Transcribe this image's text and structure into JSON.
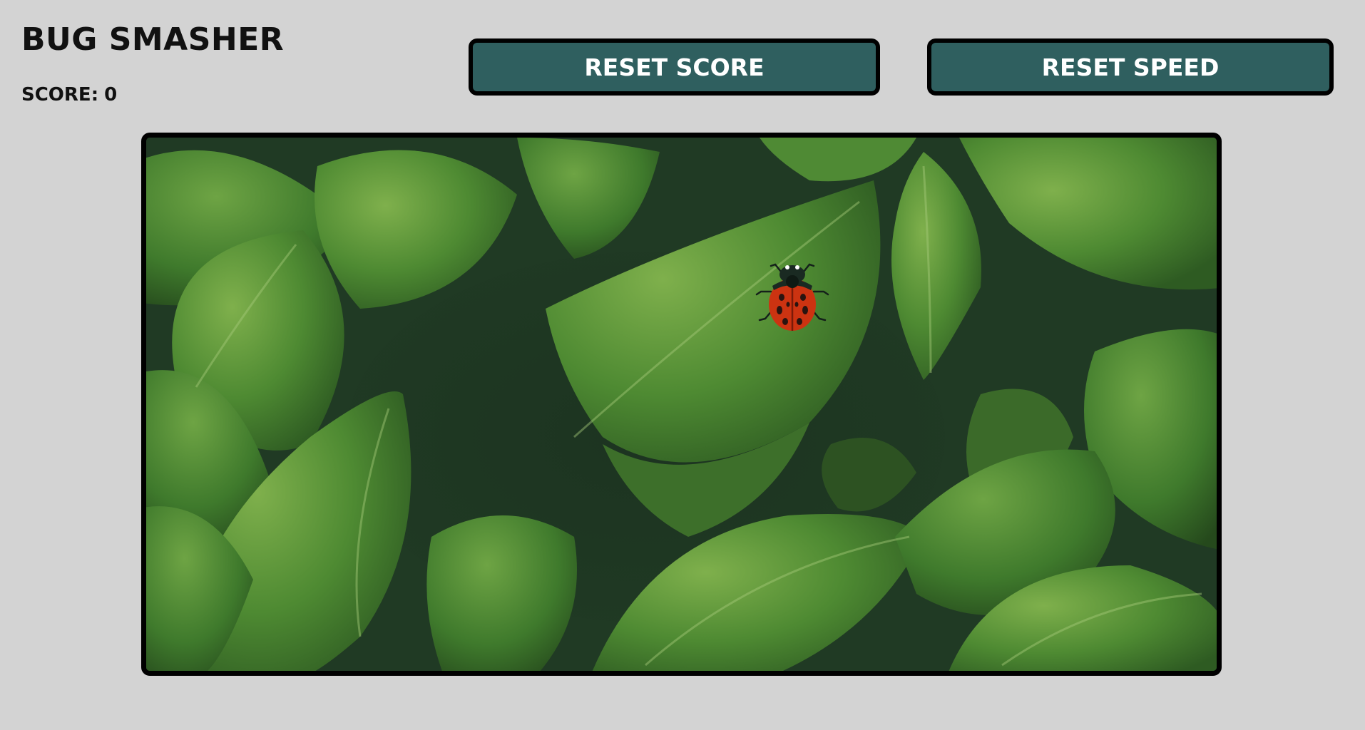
{
  "game": {
    "title": "BUG SMASHER",
    "score_label": "SCORE:",
    "score_value": "0"
  },
  "buttons": {
    "reset_score": "RESET SCORE",
    "reset_speed": "RESET SPEED"
  },
  "arena": {
    "background": "green-leaves-photo",
    "bug": "ladybug-icon"
  },
  "colors": {
    "page_background": "#d3d3d3",
    "button_fill": "#2f5f5f",
    "button_text": "#ffffff",
    "border": "#000000",
    "ladybug_red": "#cc3311"
  }
}
